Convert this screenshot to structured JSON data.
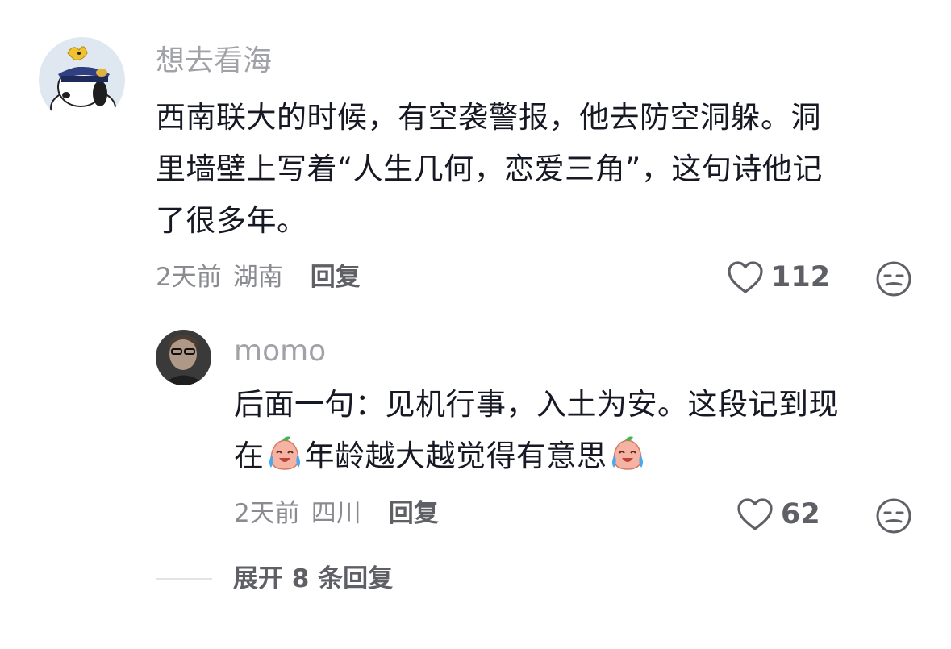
{
  "comment": {
    "username": "想去看海",
    "text_lines": [
      "西南联大的时候，有空袭警报，他去防空洞躲。洞",
      "里墙壁上写着“人生几何，恋爱三角”，这句诗他记",
      "了很多年。"
    ],
    "time": "2天前",
    "location": "湖南",
    "reply_label": "回复",
    "likes": "112",
    "like_icon": "heart-outline-icon",
    "dislike_icon": "meh-face-icon"
  },
  "reply": {
    "username": "momo",
    "text_line1": "后面一句：见机行事，入土为安。这段记到现",
    "text_line2_a": "在",
    "text_line2_b": "年龄越大越觉得有意思",
    "emoji_name": "crying-laughing-peach-emoji",
    "time": "2天前",
    "location": "四川",
    "reply_label": "回复",
    "likes": "62"
  },
  "expand": {
    "label": "展开 8 条回复"
  },
  "colors": {
    "text_primary": "#161823",
    "text_secondary": "#a1a2a7",
    "meta": "#8a8b91",
    "action": "#5f6066"
  }
}
